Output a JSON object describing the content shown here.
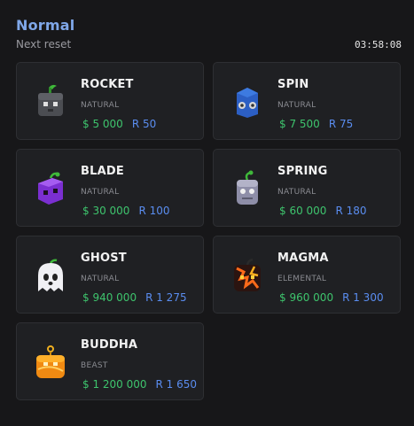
{
  "header": {
    "title": "Normal",
    "subtitle": "Next reset",
    "timer": "03:58:08"
  },
  "colors": {
    "accent": "#7fa7e8",
    "money": "#3ec46d",
    "robux": "#5a8df0",
    "card_bg": "#1f2023",
    "page_bg": "#171719"
  },
  "fruits": [
    {
      "name": "ROCKET",
      "rarity": "NATURAL",
      "money": "$ 5 000",
      "robux": "R 50",
      "icon": "rocket-fruit-icon"
    },
    {
      "name": "SPIN",
      "rarity": "NATURAL",
      "money": "$ 7 500",
      "robux": "R 75",
      "icon": "spin-fruit-icon"
    },
    {
      "name": "BLADE",
      "rarity": "NATURAL",
      "money": "$ 30 000",
      "robux": "R 100",
      "icon": "blade-fruit-icon"
    },
    {
      "name": "SPRING",
      "rarity": "NATURAL",
      "money": "$ 60 000",
      "robux": "R 180",
      "icon": "spring-fruit-icon"
    },
    {
      "name": "GHOST",
      "rarity": "NATURAL",
      "money": "$ 940 000",
      "robux": "R 1 275",
      "icon": "ghost-fruit-icon"
    },
    {
      "name": "MAGMA",
      "rarity": "ELEMENTAL",
      "money": "$ 960 000",
      "robux": "R 1 300",
      "icon": "magma-fruit-icon"
    },
    {
      "name": "BUDDHA",
      "rarity": "BEAST",
      "money": "$ 1 200 000",
      "robux": "R 1 650",
      "icon": "buddha-fruit-icon"
    }
  ]
}
